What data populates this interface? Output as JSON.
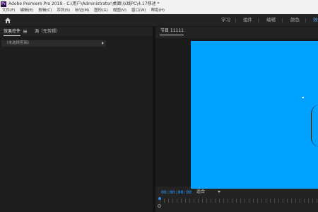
{
  "window": {
    "app_badge": "Pr",
    "title": "Adobe Premiere Pro 2019 - C:\\用户\\Administrator\\桌面\\以线PC\\4.17移述 *"
  },
  "menu": {
    "items": [
      "文件(F)",
      "编辑(E)",
      "剪辑(C)",
      "序列(S)",
      "标记(M)",
      "图形(G)",
      "视图(V)",
      "窗口(W)",
      "帮助(H)"
    ]
  },
  "workspaces": {
    "tabs": [
      "学习",
      "组件",
      "编辑",
      "颜色",
      "效"
    ],
    "active_index": 4,
    "active_color": "#4fa8ff"
  },
  "effects_panel": {
    "tab_effect_controls": "效果控件",
    "tab_audio": "源（无剪辑）",
    "no_clip_selected": "（未选择剪辑）"
  },
  "program_monitor": {
    "header": "节目 11111",
    "timecode": "00:00:00:00",
    "fit_label": "适合",
    "frame_color": "#00a2ff",
    "timecode_color": "#3a9bf0"
  }
}
